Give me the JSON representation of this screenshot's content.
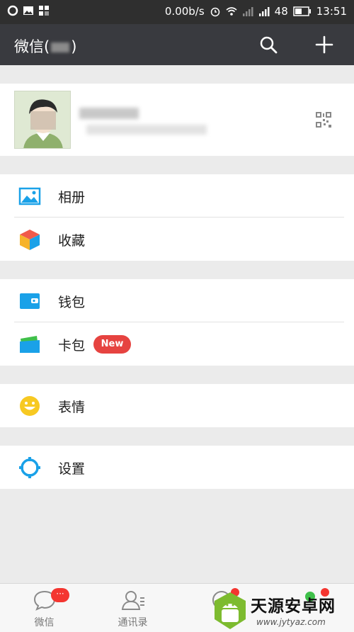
{
  "status_bar": {
    "speed": "0.00b/s",
    "signal_strength": "48",
    "time": "13:51"
  },
  "header": {
    "title_prefix": "微信(",
    "title_suffix": ")"
  },
  "menu": {
    "album": "相册",
    "favorites": "收藏",
    "wallet": "钱包",
    "card_wallet": "卡包",
    "card_badge": "New",
    "stickers": "表情",
    "settings": "设置"
  },
  "tabbar": {
    "chats": "微信",
    "contacts": "通讯录",
    "chats_badge": "···"
  },
  "watermark": {
    "brand": "天源安卓网",
    "url": "www.jytyaz.com"
  },
  "colors": {
    "header_bg": "#393a3f",
    "accent_blue": "#1aa1e8",
    "badge_red": "#e64340"
  }
}
